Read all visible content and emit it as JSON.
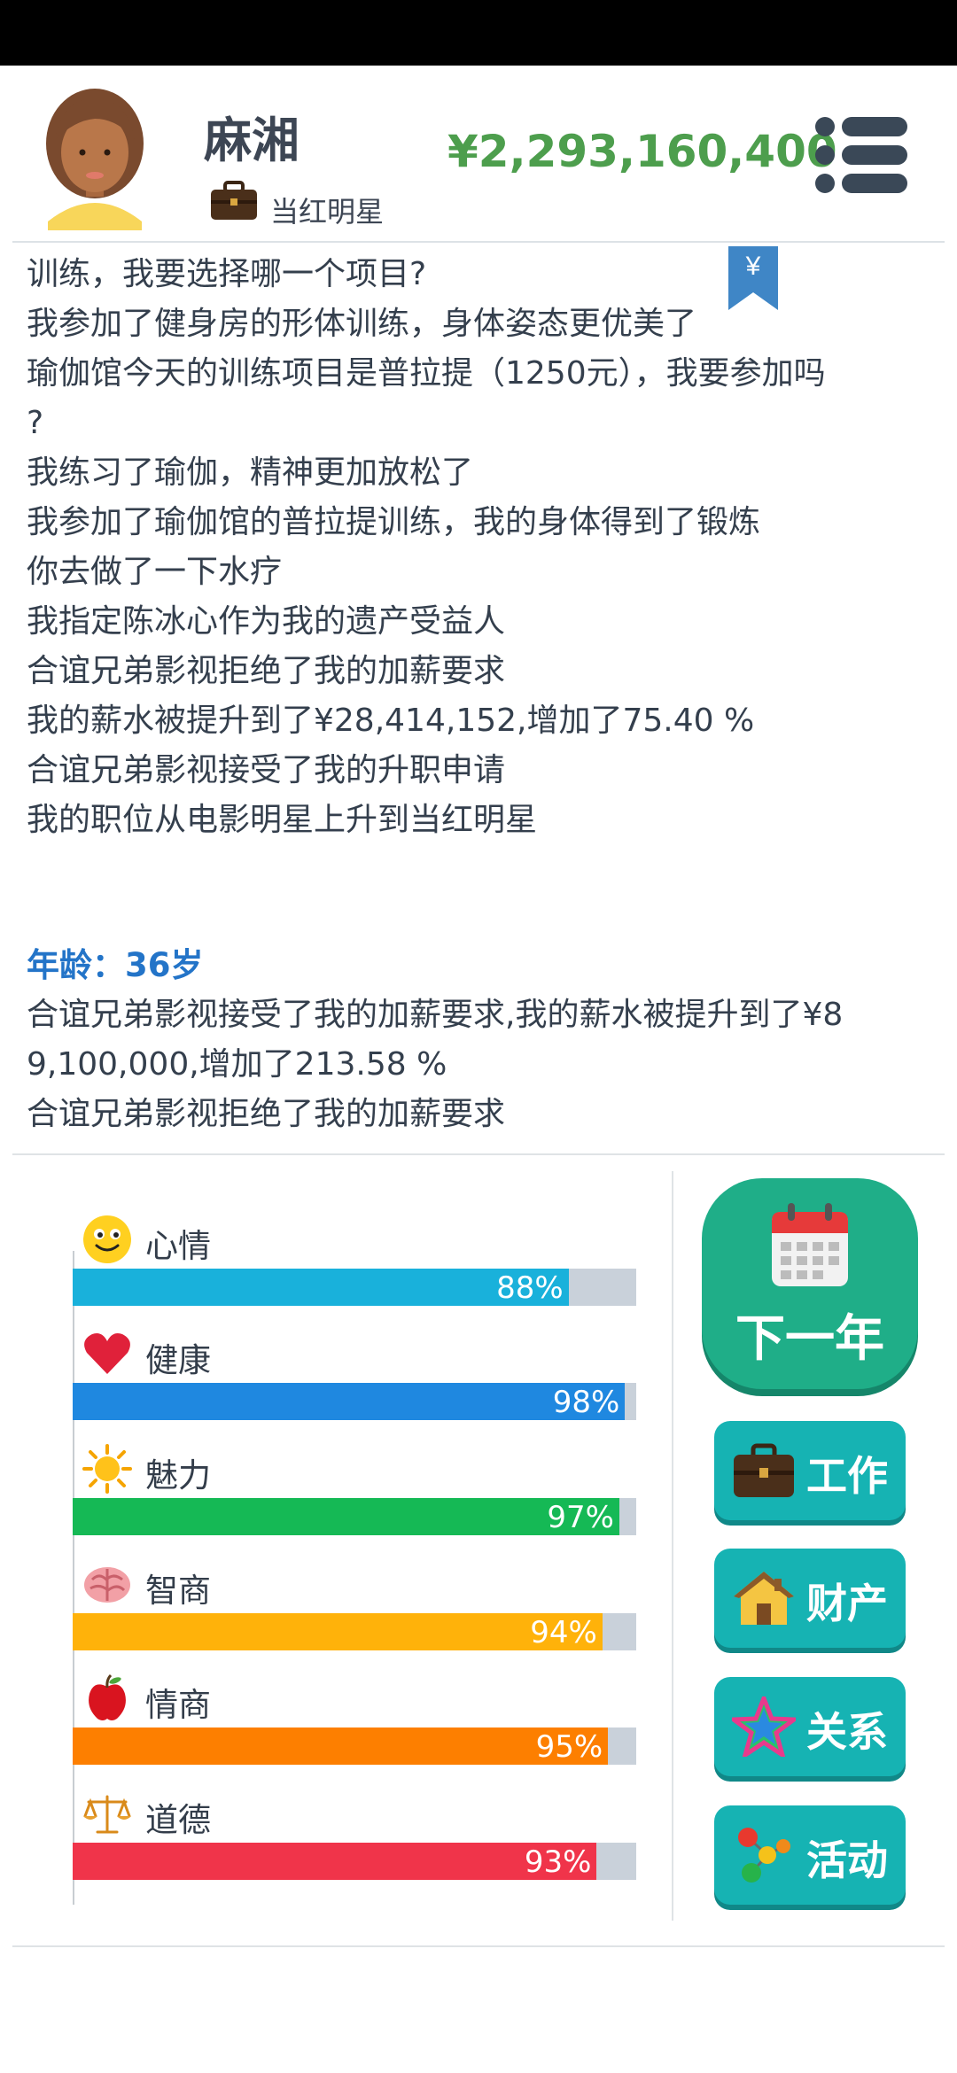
{
  "header": {
    "name": "麻湘",
    "job_title": "当红明星",
    "money": "¥2,293,160,400"
  },
  "bookmark_symbol": "¥",
  "log": {
    "lines_before": [
      "训练，我要选择哪一个项目?",
      "我参加了健身房的形体训练，身体姿态更优美了",
      "瑜伽馆今天的训练项目是普拉提（1250元），我要参加吗\n?",
      "我练习了瑜伽，精神更加放松了",
      "我参加了瑜伽馆的普拉提训练，我的身体得到了锻炼",
      "你去做了一下水疗",
      "我指定陈冰心作为我的遗产受益人",
      "合谊兄弟影视拒绝了我的加薪要求",
      "我的薪水被提升到了¥28,414,152,增加了75.40 %",
      "合谊兄弟影视接受了我的升职申请",
      "我的职位从电影明星上升到当红明星"
    ],
    "age_heading": "年龄：36岁",
    "lines_after": [
      "合谊兄弟影视接受了我的加薪要求,我的薪水被提升到了¥8\n9,100,000,增加了213.58 %",
      "合谊兄弟影视拒绝了我的加薪要求"
    ]
  },
  "stats": [
    {
      "label": "心情",
      "value": 88,
      "pct": "88%",
      "color": "#19b1db",
      "icon": "smiley-face-icon"
    },
    {
      "label": "健康",
      "value": 98,
      "pct": "98%",
      "color": "#1f88e0",
      "icon": "heart-icon"
    },
    {
      "label": "魅力",
      "value": 97,
      "pct": "97%",
      "color": "#15b955",
      "icon": "sun-icon"
    },
    {
      "label": "智商",
      "value": 94,
      "pct": "94%",
      "color": "#ffb20a",
      "icon": "brain-icon"
    },
    {
      "label": "情商",
      "value": 95,
      "pct": "95%",
      "color": "#fd7f00",
      "icon": "apple-icon"
    },
    {
      "label": "道德",
      "value": 93,
      "pct": "93%",
      "color": "#f0344a",
      "icon": "scales-icon"
    }
  ],
  "buttons": {
    "next_year": "下一年",
    "work": "工作",
    "property": "财产",
    "relations": "关系",
    "activities": "活动"
  }
}
